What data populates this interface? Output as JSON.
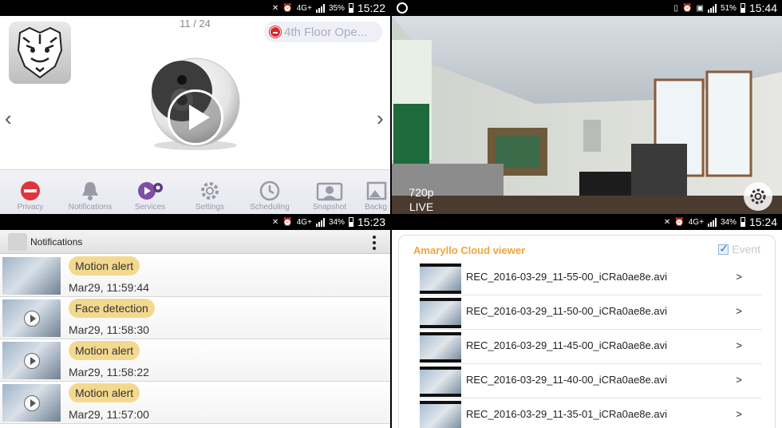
{
  "panel1": {
    "status": {
      "network": "4G+",
      "battery": "35%",
      "time": "15:22"
    },
    "counter": "11 / 24",
    "camera_name": "4th Floor Ope...",
    "toolbar": [
      {
        "label": "Privacy",
        "icon": "privacy-icon"
      },
      {
        "label": "Notifications",
        "icon": "bell-icon"
      },
      {
        "label": "Services",
        "icon": "services-icon"
      },
      {
        "label": "Settings",
        "icon": "gear-icon"
      },
      {
        "label": "Scheduling",
        "icon": "clock-icon"
      },
      {
        "label": "Snapshot",
        "icon": "camera-icon"
      },
      {
        "label": "Backg",
        "icon": "background-icon"
      }
    ]
  },
  "panel2": {
    "status": {
      "battery": "51%",
      "time": "15:44"
    },
    "resolution": "720p",
    "mode": "LIVE"
  },
  "panel3": {
    "status": {
      "network": "4G+",
      "battery": "34%",
      "time": "15:23"
    },
    "title": "Notifications",
    "items": [
      {
        "type": "Motion alert",
        "time": "Mar29, 11:59:44",
        "play": false
      },
      {
        "type": "Face detection",
        "time": "Mar29, 11:58:30",
        "play": true
      },
      {
        "type": "Motion alert",
        "time": "Mar29, 11:58:22",
        "play": true
      },
      {
        "type": "Motion alert",
        "time": "Mar29, 11:57:00",
        "play": true
      }
    ]
  },
  "panel4": {
    "status": {
      "network": "4G+",
      "battery": "34%",
      "time": "15:24"
    },
    "title": "Amaryllo Cloud viewer",
    "event_label": "Event",
    "recordings": [
      {
        "name": "REC_2016-03-29_11-55-00_iCRa0ae8e.avi",
        "arrow": ">"
      },
      {
        "name": "REC_2016-03-29_11-50-00_iCRa0ae8e.avi",
        "arrow": ">"
      },
      {
        "name": "REC_2016-03-29_11-45-00_iCRa0ae8e.avi",
        "arrow": ">"
      },
      {
        "name": "REC_2016-03-29_11-40-00_iCRa0ae8e.avi",
        "arrow": ">"
      },
      {
        "name": "REC_2016-03-29_11-35-01_iCRa0ae8e.avi",
        "arrow": ">"
      }
    ]
  }
}
